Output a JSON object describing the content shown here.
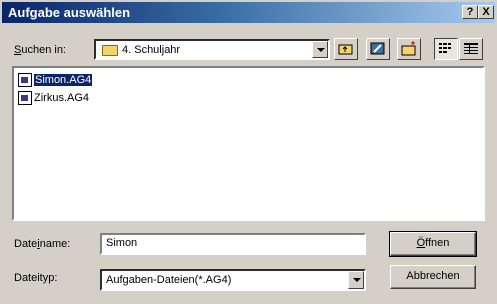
{
  "window": {
    "title": "Aufgabe auswählen",
    "help_label": "?",
    "close_label": "X"
  },
  "lookin": {
    "label_prefix": "",
    "label_underline": "S",
    "label_rest": "uchen in:",
    "value": "4. Schuljahr"
  },
  "toolbar": {
    "icons": [
      "up-folder-icon",
      "desktop-icon",
      "new-folder-icon",
      "list-view-icon",
      "details-view-icon"
    ]
  },
  "files": [
    {
      "name": "Simon.AG4",
      "selected": true
    },
    {
      "name": "Zirkus.AG4",
      "selected": false
    }
  ],
  "filename": {
    "label_prefix": "Date",
    "label_underline": "i",
    "label_rest": "name:",
    "value": "Simon"
  },
  "filetype": {
    "label": "Dateityp:",
    "value": "Aufgaben-Dateien(*.AG4)"
  },
  "buttons": {
    "open_underline": "Ö",
    "open_rest": "ffnen",
    "cancel": "Abbrechen"
  }
}
